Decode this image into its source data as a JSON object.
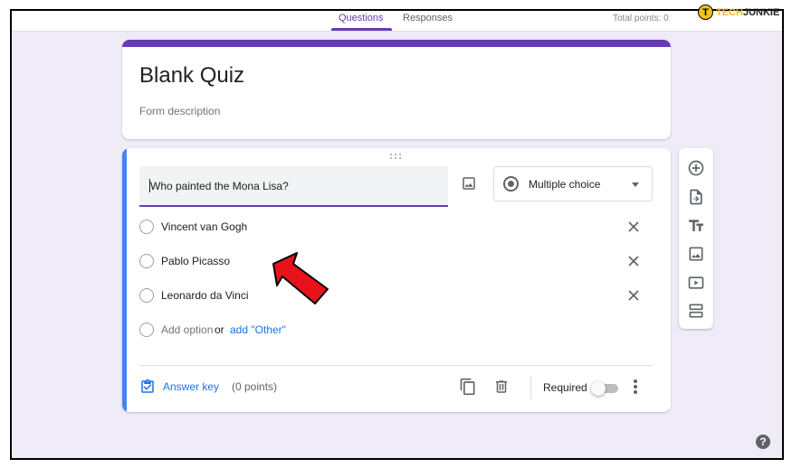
{
  "header": {
    "tabs": [
      {
        "label": "Questions",
        "active": true
      },
      {
        "label": "Responses",
        "active": false
      }
    ],
    "total_points": "Total points: 0"
  },
  "watermark": {
    "badge": "T",
    "tech": "TECH",
    "junkie": "JUNKIE"
  },
  "form": {
    "title": "Blank Quiz",
    "description_placeholder": "Form description"
  },
  "question": {
    "text": "Who painted the Mona Lisa?",
    "type": "Multiple choice",
    "options": [
      {
        "label": "Vincent van Gogh"
      },
      {
        "label": "Pablo Picasso"
      },
      {
        "label": "Leonardo da Vinci"
      }
    ],
    "add_option": "Add option",
    "or": "or",
    "add_other": "add \"Other\"",
    "answer_key": "Answer key",
    "points": "(0 points)",
    "required_label": "Required",
    "required": false
  },
  "toolbox": [
    "add-question-icon",
    "import-questions-icon",
    "add-title-icon",
    "add-image-icon",
    "add-video-icon",
    "add-section-icon"
  ],
  "help": "?",
  "colors": {
    "accent": "#673ab7",
    "link": "#1a73e8",
    "active_bar": "#4285f4",
    "background": "#efebf7",
    "arrow": "#e8121a"
  }
}
